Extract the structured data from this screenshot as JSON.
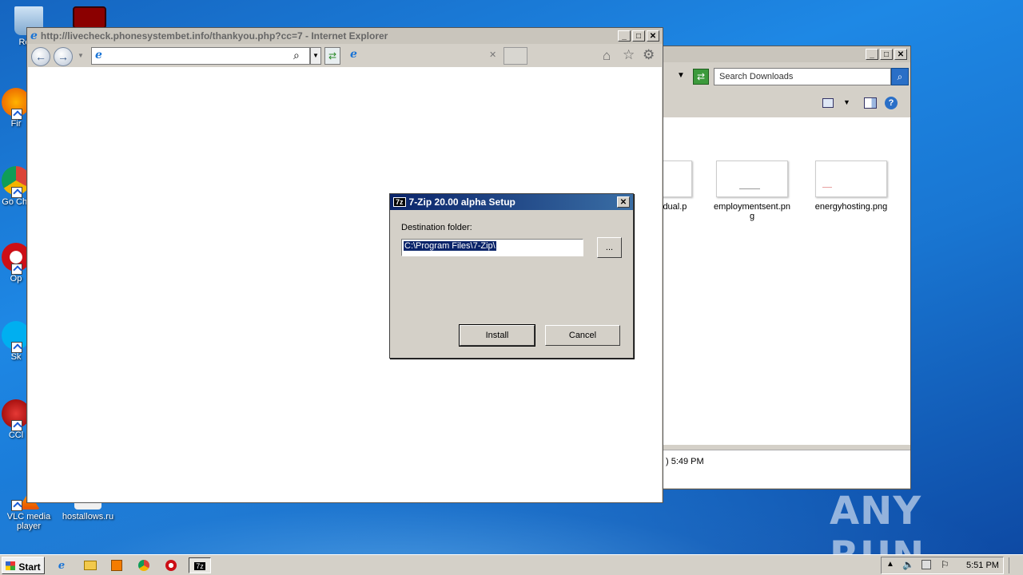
{
  "desktop": {
    "icons": [
      {
        "label": "Recy"
      },
      {
        "label": "Fir"
      },
      {
        "label": "Go Chr"
      },
      {
        "label": "Op"
      },
      {
        "label": "Sk"
      },
      {
        "label": "CCl"
      },
      {
        "label": "VLC media player"
      },
      {
        "label": "hostallows.ru"
      }
    ]
  },
  "ie": {
    "title": "http://livecheck.phonesystembet.info/thankyou.php?cc=7 - Internet Explorer",
    "address_value": ""
  },
  "explorer": {
    "search_placeholder": "Search Downloads",
    "files": [
      {
        "name": "idual.p"
      },
      {
        "name": "employmentsent.png"
      },
      {
        "name": "energyhosting.png"
      }
    ],
    "status_text": ") 5:49 PM"
  },
  "sevenzip": {
    "icon_text": "7z",
    "title": "7-Zip 20.00 alpha Setup",
    "destination_label": "Destination folder:",
    "destination_value": "C:\\Program Files\\7-Zip\\",
    "browse_label": "...",
    "install_label": "Install",
    "cancel_label": "Cancel"
  },
  "watermark": "ANY RUN",
  "taskbar": {
    "start_label": "Start",
    "clock": "5:51 PM",
    "pinned_7z": "7z"
  },
  "colors": {
    "title_active": "#0a246a",
    "selection": "#0a246a",
    "dialog_face": "#d4d0c8"
  }
}
